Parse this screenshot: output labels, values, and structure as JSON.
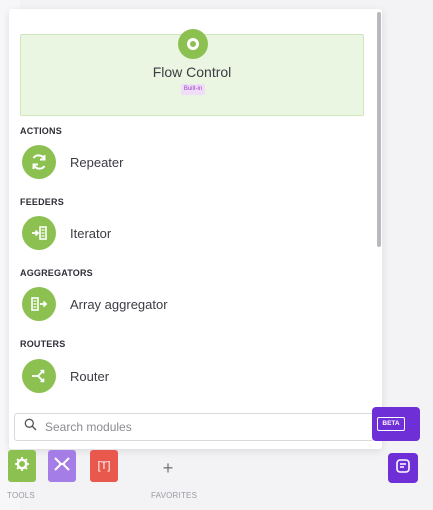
{
  "header": {
    "title": "Flow Control",
    "badge": "Built-in",
    "icon": "flow-control-ring-icon"
  },
  "sections": [
    {
      "label": "ACTIONS",
      "module": {
        "name": "Repeater",
        "icon": "repeat-icon"
      }
    },
    {
      "label": "FEEDERS",
      "module": {
        "name": "Iterator",
        "icon": "iterator-icon"
      }
    },
    {
      "label": "AGGREGATORS",
      "module": {
        "name": "Array aggregator",
        "icon": "array-aggregator-icon"
      }
    },
    {
      "label": "ROUTERS",
      "module": {
        "name": "Router",
        "icon": "router-icon"
      }
    }
  ],
  "search": {
    "placeholder": "Search modules",
    "value": ""
  },
  "toolbar": {
    "tools_label": "TOOLS",
    "favorites_label": "FAVORITES",
    "text_tool_glyph": "[T]",
    "add_favorite_glyph": "+"
  },
  "beta": {
    "label": "BETA"
  },
  "colors": {
    "accent_green": "#8cc152",
    "header_bg": "#eaf6e1",
    "badge_bg": "#f0ddf8",
    "badge_text": "#9c3fc8",
    "purple": "#6f2fd6",
    "flow_purple": "#a47ee6",
    "text_red": "#e9584c"
  }
}
